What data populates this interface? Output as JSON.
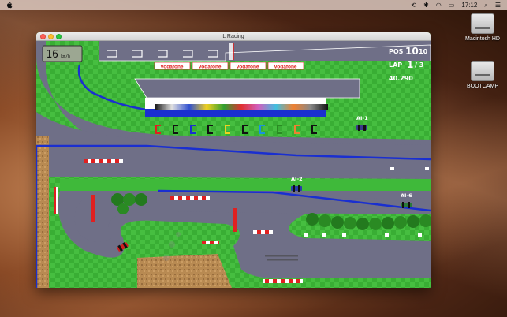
{
  "menubar": {
    "time": "17:12",
    "icons": [
      "apple-icon",
      "time-machine-icon",
      "bluetooth-icon",
      "wifi-icon",
      "battery-icon",
      "search-icon",
      "list-icon"
    ]
  },
  "desktop": {
    "icons": [
      {
        "label": "Macintosh HD",
        "icon": "hard-drive-icon"
      },
      {
        "label": "BOOTCAMP",
        "icon": "hard-drive-icon"
      }
    ]
  },
  "window": {
    "title": "L Racing"
  },
  "hud": {
    "pos_label": "POS",
    "pos_value": "10",
    "pos_total": "10",
    "lap_label": "LAP",
    "lap_value": "1",
    "lap_total": "/ 3",
    "time": "40.290",
    "speed_value": "16",
    "speed_unit": "km/h"
  },
  "track": {
    "sponsor_banner": "Vodafone",
    "cars": [
      {
        "label": "AI-1",
        "color": "#3a3a8a"
      },
      {
        "label": "AI-2",
        "color": "#2a3aa8"
      },
      {
        "label": "AI-6",
        "color": "#2a7a3a"
      }
    ],
    "colors": {
      "grass": "#3fb93a",
      "asphalt": "#6f6f87",
      "kerb_red": "#e02020",
      "barrier_blue": "#1a2fd0",
      "gravel": "#b88a52"
    }
  }
}
